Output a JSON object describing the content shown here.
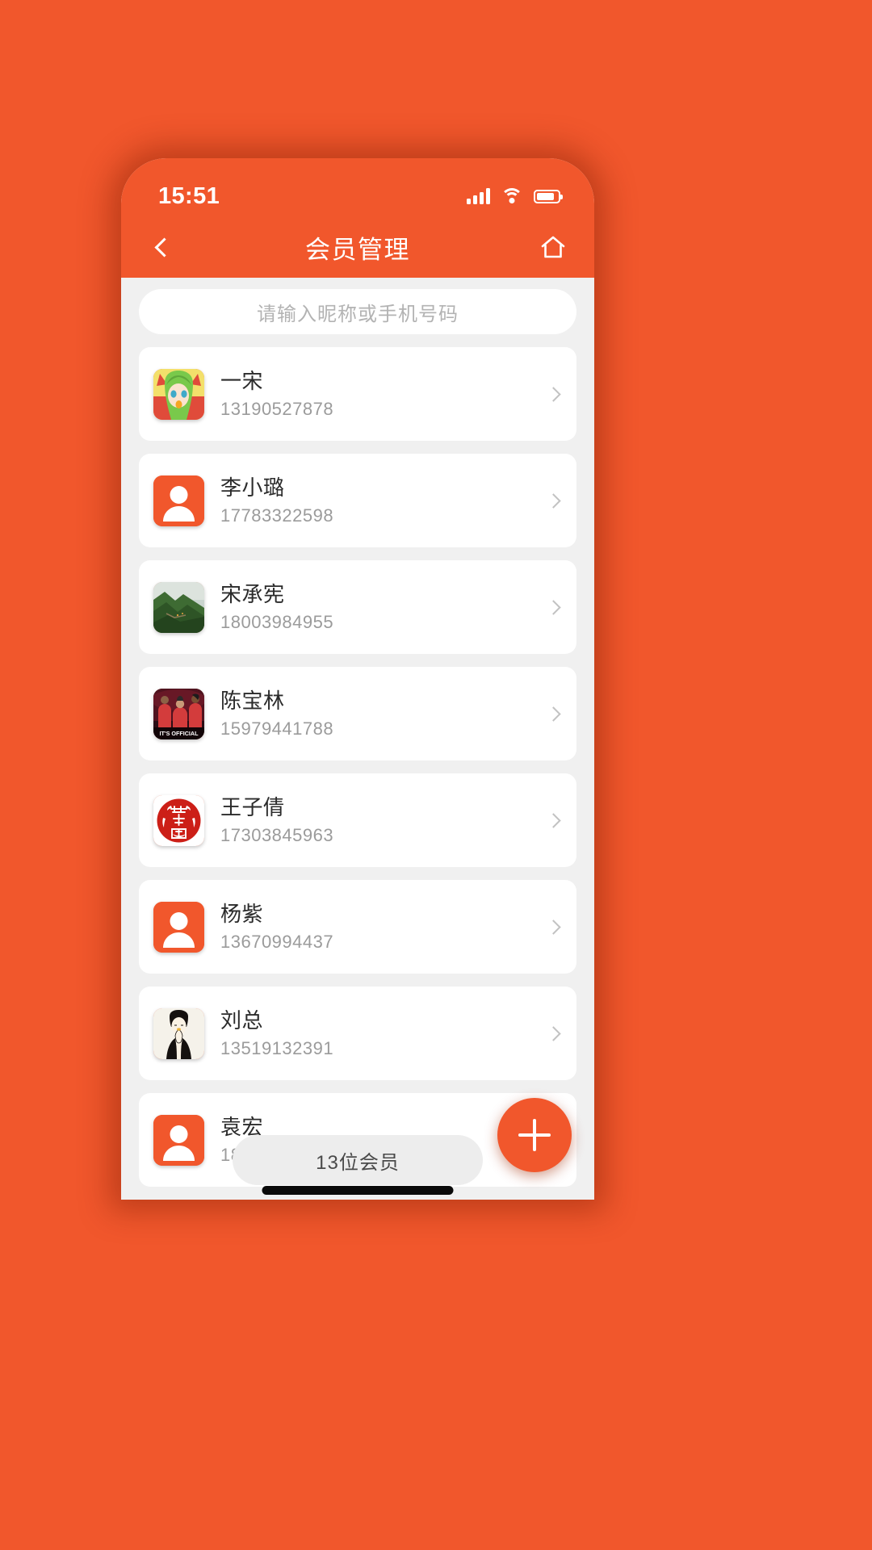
{
  "theme": {
    "accent": "#F1572C",
    "page_bg": "#F0F0F0",
    "card_bg": "#FFFFFF",
    "name_color": "#2B2B2B",
    "phone_color": "#9B9B9B"
  },
  "status_bar": {
    "time": "15:51",
    "signal_icon": "signal-bars-icon",
    "wifi_icon": "wifi-icon",
    "battery_icon": "battery-icon",
    "battery_level": 82
  },
  "nav_bar": {
    "back_icon": "chevron-left-icon",
    "title": "会员管理",
    "home_icon": "home-icon"
  },
  "search": {
    "placeholder": "请输入昵称或手机号码",
    "value": ""
  },
  "members": [
    {
      "name": "一宋",
      "phone": "13190527878",
      "avatar_type": "photo-anime",
      "chevron": "chevron-right-icon"
    },
    {
      "name": "李小璐",
      "phone": "17783322598",
      "avatar_type": "default-person",
      "chevron": "chevron-right-icon"
    },
    {
      "name": "宋承宪",
      "phone": "18003984955",
      "avatar_type": "photo-landscape",
      "chevron": "chevron-right-icon"
    },
    {
      "name": "陈宝林",
      "phone": "15979441788",
      "avatar_type": "photo-basketball",
      "chevron": "chevron-right-icon"
    },
    {
      "name": "王子倩",
      "phone": "17303845963",
      "avatar_type": "photo-seal",
      "chevron": "chevron-right-icon"
    },
    {
      "name": "杨紫",
      "phone": "13670994437",
      "avatar_type": "default-person",
      "chevron": "chevron-right-icon"
    },
    {
      "name": "刘总",
      "phone": "13519132391",
      "avatar_type": "photo-illustration",
      "chevron": "chevron-right-icon"
    },
    {
      "name": "袁宏",
      "phone": "18501574458",
      "avatar_type": "default-person",
      "chevron": "chevron-right-icon"
    },
    {
      "name": "",
      "phone": "",
      "avatar_type": "photo-basketball",
      "chevron": "chevron-right-icon"
    }
  ],
  "footer": {
    "member_count_label": "13位会员",
    "add_button_icon": "plus-icon"
  }
}
